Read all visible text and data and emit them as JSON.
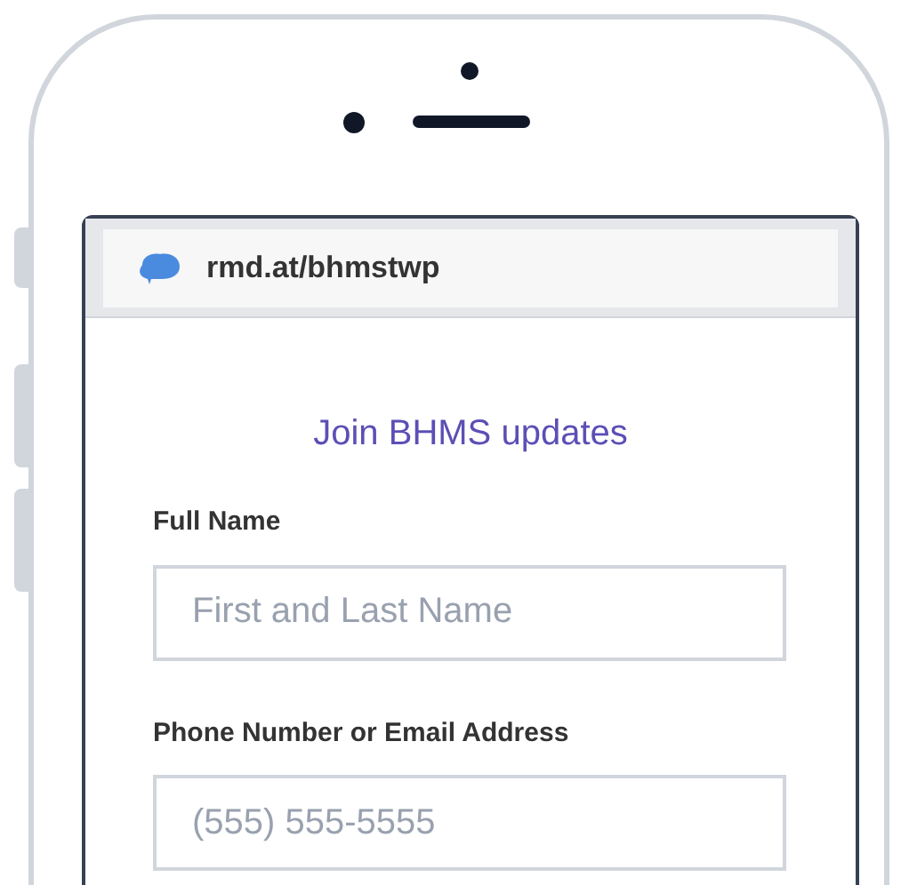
{
  "browser": {
    "url": "rmd.at/bhmstwp"
  },
  "form": {
    "title": "Join BHMS updates",
    "fields": [
      {
        "label": "Full Name",
        "placeholder": "First and Last Name"
      },
      {
        "label": "Phone Number or Email Address",
        "placeholder": "(555) 555-5555"
      }
    ]
  }
}
